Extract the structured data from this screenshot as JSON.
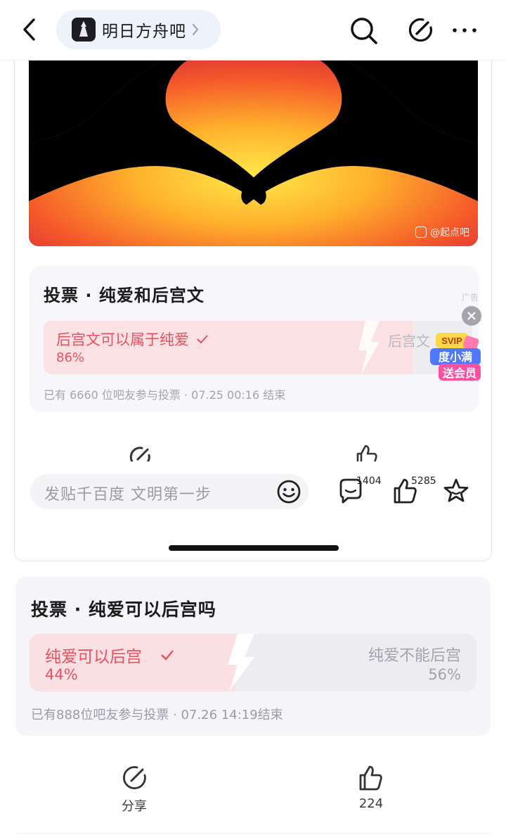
{
  "header": {
    "forum_name": "明日方舟吧",
    "icons": [
      "back-icon",
      "search-icon",
      "compose-icon",
      "more-icon"
    ]
  },
  "embedded_post": {
    "image_watermark": "@起点吧",
    "vote": {
      "title": "投票 · 纯爱和后宫文",
      "ad_tag": "广告",
      "option_left": "后宫文可以属于纯爱",
      "option_left_pct": "86%",
      "option_left_fraction": 0.86,
      "option_right": "后宫文",
      "footer": "已有 6660 位吧友参与投票 · 07.25 00:16 结束"
    },
    "promo": {
      "badge_top": "SVIP",
      "badge_line1": "度小满",
      "badge_line2": "送会员"
    },
    "comment_bar": {
      "placeholder": "发贴千百度 文明第一步",
      "comment_count": "1404",
      "like_count": "5285"
    }
  },
  "vote": {
    "title": "投票 · 纯爱可以后宫吗",
    "option_left": "纯爱可以后宫",
    "option_left_pct": "44%",
    "option_left_fraction": 0.44,
    "option_right": "纯爱不能后宫",
    "option_right_pct": "56%",
    "footer": "已有888位吧友参与投票 · 07.26 14:19结束"
  },
  "actions": {
    "share_label": "分享",
    "like_count": "224"
  },
  "colors": {
    "accent_red": "#e8515d",
    "pill_bg": "#eef2fb",
    "card_bg": "#f5f5f9"
  }
}
